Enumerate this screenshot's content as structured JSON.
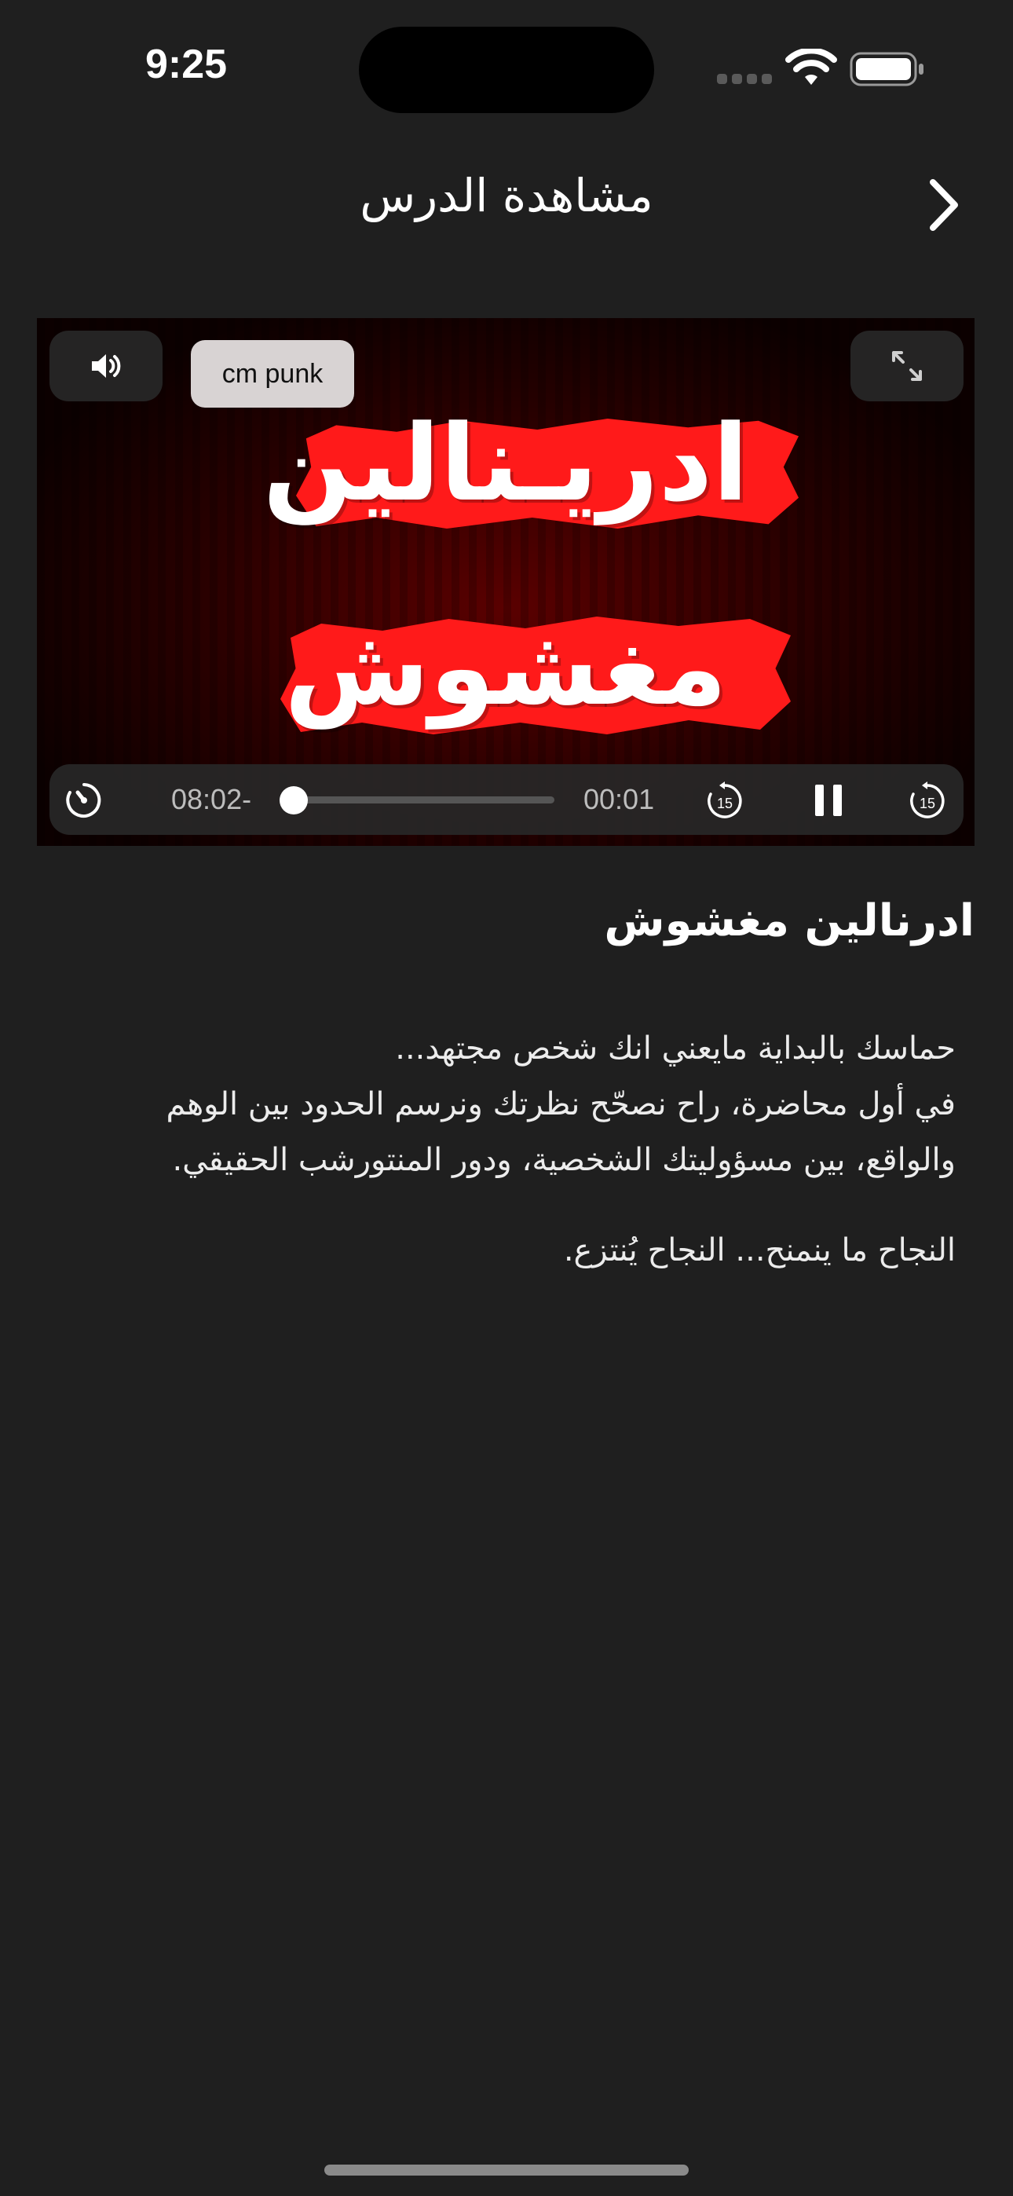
{
  "status_bar": {
    "time": "9:25",
    "icons": [
      "signal-icon",
      "wifi-icon",
      "battery-icon"
    ]
  },
  "nav": {
    "title": "مشاهدة الدرس",
    "back_icon": "chevron-icon"
  },
  "video": {
    "title_line_1": "ادريـنالين",
    "title_line_2": "مغشوش",
    "chip_label": "cm punk",
    "remaining_time": "08:02-",
    "elapsed_time": "00:01",
    "progress": 0.002,
    "skip_back_label": "15",
    "skip_forward_label": "15",
    "brand_color": "#ff1a1a",
    "icons": [
      "volume-icon",
      "fullscreen-icon",
      "speed-icon",
      "skip-back-15-icon",
      "pause-icon",
      "skip-forward-15-icon"
    ]
  },
  "lesson": {
    "title": "ادرنالين مغشوش",
    "description_line_1": "حماسك بالبداية مايعني انك شخص مجتهد...",
    "description_line_2": "في أول محاضرة، راح نصحّح نظرتك ونرسم الحدود بين الوهم والواقع، بين مسؤوليتك الشخصية، ودور المنتورشب الحقيقي.",
    "description_line_3": "النجاح ما ينمنح... النجاح يُنتزع."
  }
}
